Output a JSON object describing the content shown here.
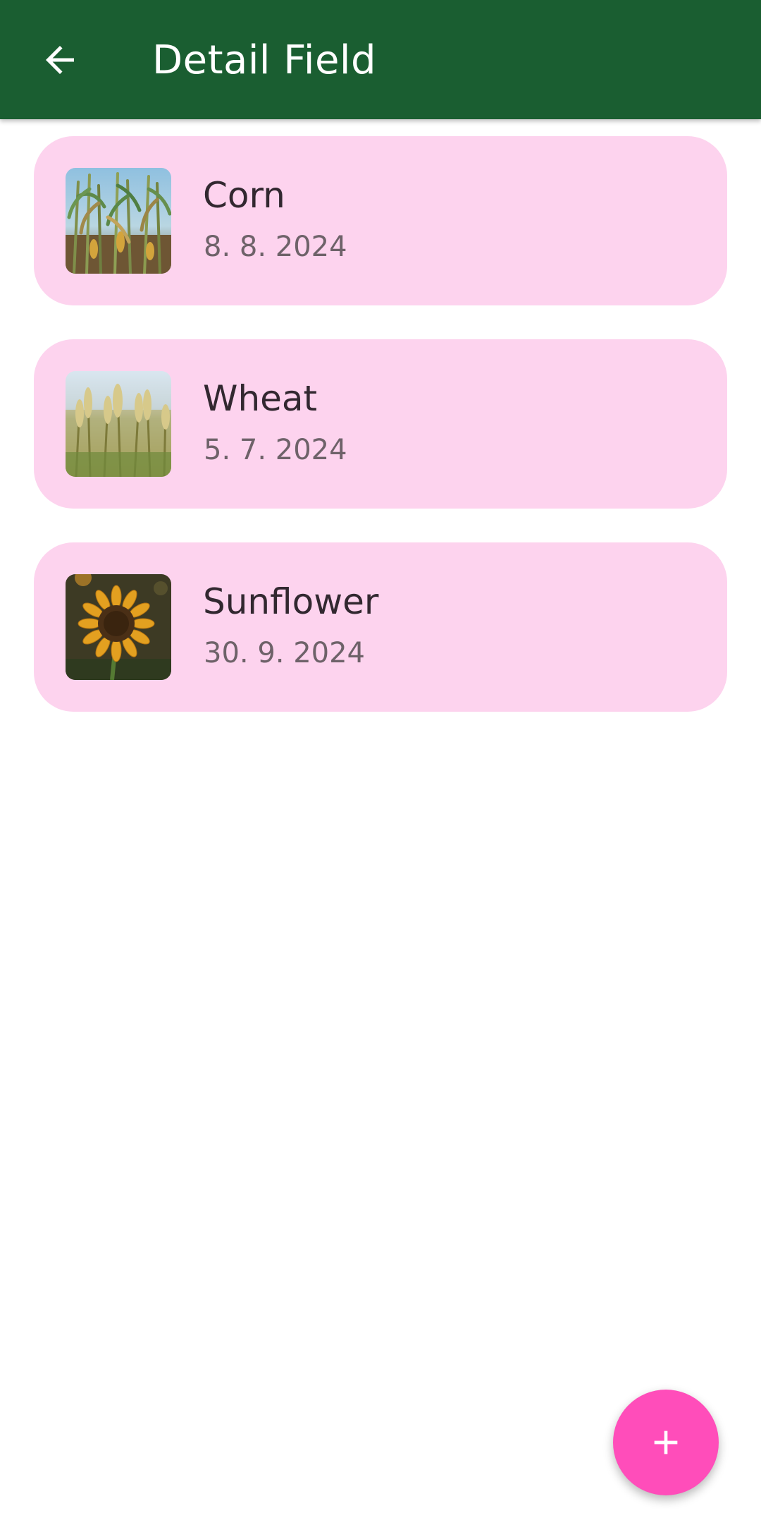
{
  "app_bar": {
    "title": "Detail Field",
    "back_icon": "arrow-back-icon",
    "color": "#1a5e31"
  },
  "crops": [
    {
      "name": "Corn",
      "date": "8. 8. 2024",
      "image": "corn-field-photo"
    },
    {
      "name": "Wheat",
      "date": "5. 7. 2024",
      "image": "wheat-field-photo"
    },
    {
      "name": "Sunflower",
      "date": "30. 9. 2024",
      "image": "sunflower-photo"
    }
  ],
  "card_color": "#fdd3ee",
  "fab": {
    "icon": "plus-icon",
    "color": "#ff4dba"
  }
}
